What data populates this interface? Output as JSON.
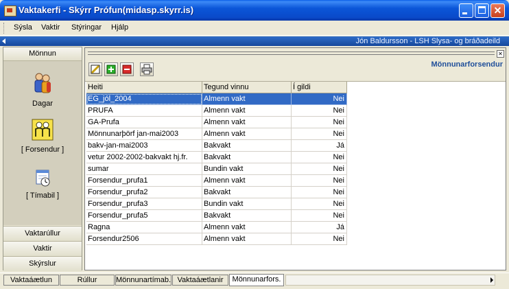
{
  "window": {
    "title": "Vaktakerfi - Skýrr Prófun(midasp.skyrr.is)"
  },
  "menu": {
    "items": [
      "Sýsla",
      "Vaktir",
      "Stýringar",
      "Hjálp"
    ]
  },
  "userbar": {
    "text": "Jón Baldursson - LSH Slysa- og bráðadeild"
  },
  "sidebar": {
    "header": "Mönnun",
    "items": [
      {
        "label": "Dagar",
        "icon": "people-icon"
      },
      {
        "label": "[ Forsendur ]",
        "icon": "forsendur-people-icon"
      },
      {
        "label": "[ Tímabil ]",
        "icon": "calendar-clock-icon"
      }
    ],
    "bottom": [
      "Vaktarúllur",
      "Vaktir",
      "Skýrslur"
    ]
  },
  "panel": {
    "title": "Mönnunarforsendur",
    "toolbar": [
      "edit-icon",
      "add-icon",
      "remove-icon",
      "print-icon"
    ],
    "columns": [
      "Heiti",
      "Tegund vinnu",
      "Í gildi"
    ],
    "rows": [
      [
        "EG_jól_2004",
        "Almenn vakt",
        "Nei"
      ],
      [
        "PRUFA",
        "Almenn vakt",
        "Nei"
      ],
      [
        "GA-Prufa",
        "Almenn vakt",
        "Nei"
      ],
      [
        "Mönnunarþörf jan-mai2003",
        "Almenn vakt",
        "Nei"
      ],
      [
        "bakv-jan-mai2003",
        "Bakvakt",
        "Já"
      ],
      [
        "vetur 2002-2002-bakvakt hj.fr.",
        "Bakvakt",
        "Nei"
      ],
      [
        "sumar",
        "Bundin vakt",
        "Nei"
      ],
      [
        "Forsendur_prufa1",
        "Almenn vakt",
        "Nei"
      ],
      [
        "Forsendur_prufa2",
        "Bakvakt",
        "Nei"
      ],
      [
        "Forsendur_prufa3",
        "Bundin vakt",
        "Nei"
      ],
      [
        "Forsendur_prufa5",
        "Bakvakt",
        "Nei"
      ],
      [
        "Ragna",
        "Almenn vakt",
        "Já"
      ],
      [
        "Forsendur2506",
        "Almenn vakt",
        "Nei"
      ]
    ],
    "selected_row": 0
  },
  "tabs": [
    "Vaktaáætlun",
    "Rúllur",
    "Mönnunartímab.",
    "Vaktaáætlanir",
    "Mönnunarfors."
  ],
  "active_tab": 4,
  "colors": {
    "selection": "#316ac5",
    "titlebar": "#0a49c9",
    "panel_title": "#1f4e9a"
  }
}
